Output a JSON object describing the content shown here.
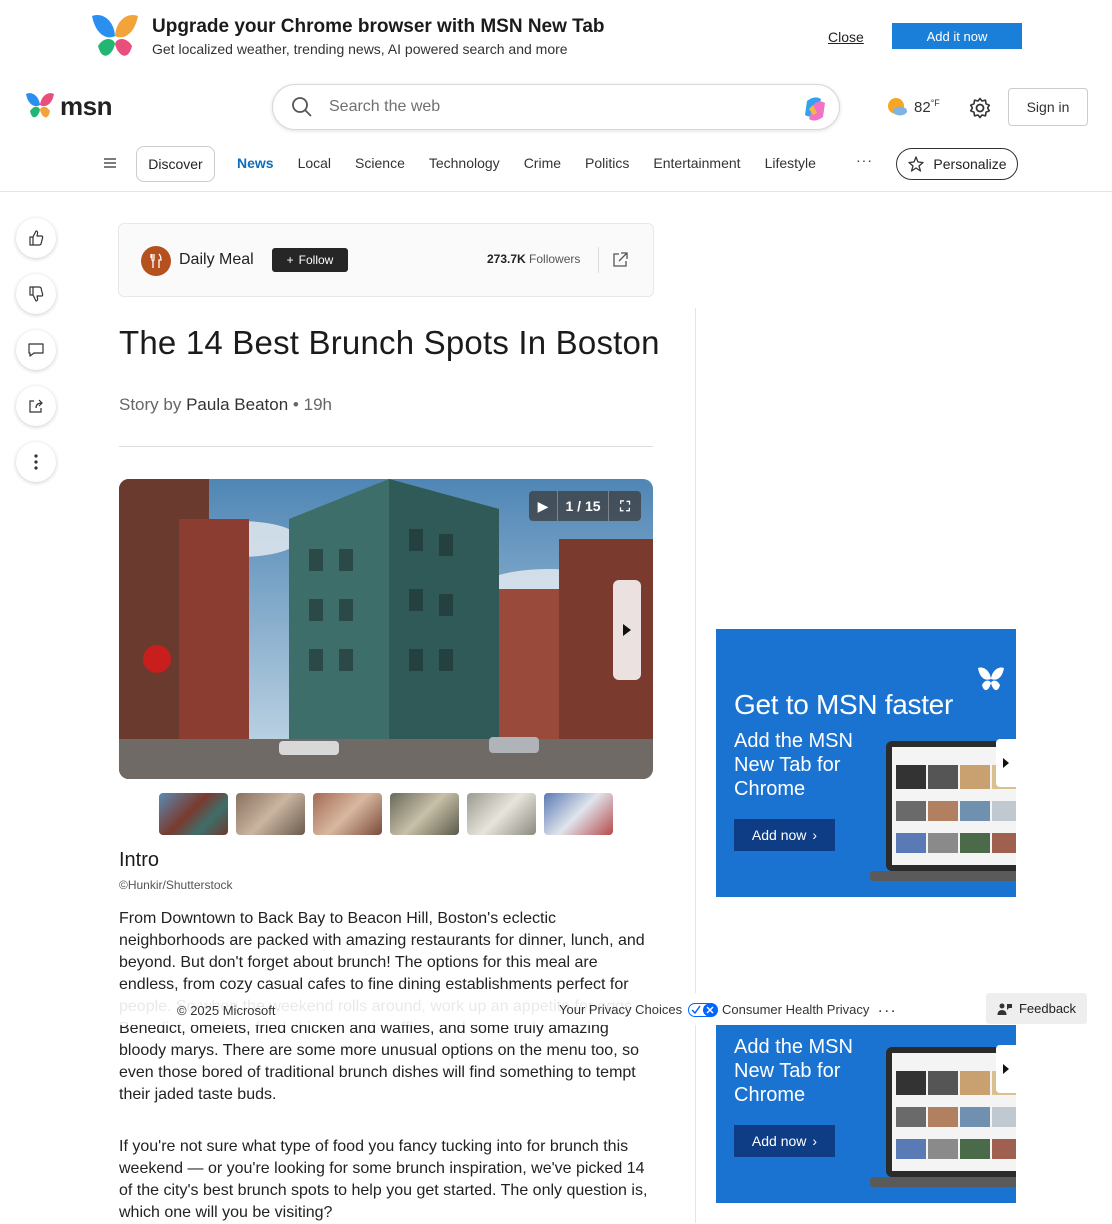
{
  "banner": {
    "title": "Upgrade your Chrome browser with MSN New Tab",
    "subtitle": "Get localized weather, trending news, AI powered search and more",
    "close_label": "Close",
    "add_label": "Add it now"
  },
  "header": {
    "logo_text": "msn",
    "search_placeholder": "Search the web",
    "temperature": "82",
    "temp_unit": "°F",
    "signin_label": "Sign in"
  },
  "nav": {
    "discover": "Discover",
    "items": [
      "News",
      "Local",
      "Science",
      "Technology",
      "Crime",
      "Politics",
      "Entertainment",
      "Lifestyle"
    ],
    "more": "···",
    "personalize": "Personalize"
  },
  "publisher": {
    "name": "Daily Meal",
    "follow_label": "Follow",
    "followers_count": "273.7K",
    "followers_label": "Followers"
  },
  "article": {
    "title": "The 14 Best Brunch Spots In Boston",
    "story_by": "Story by",
    "author": "Paula Beaton",
    "separator": "•",
    "age": "19h",
    "gallery_counter": "1 / 15",
    "section_title": "Intro",
    "image_credit": "©Hunkir/Shutterstock",
    "paragraph1": "From Downtown to Back Bay to Beacon Hill, Boston's eclectic neighborhoods are packed with amazing restaurants for dinner, lunch, and beyond. But don't forget about brunch! The options for this meal are endless, from cozy casual cafes to fine dining establishments perfect for people. So when the weekend rolls around, work up an appetite for eggs Benedict, omelets, fried chicken and waffles, and some truly amazing bloody marys. There are some more unusual options on the menu too, so even those bored of traditional brunch dishes will find something to tempt their jaded taste buds.",
    "paragraph2": "If you're not sure what type of food you fancy tucking into for brunch this weekend — or you're looking for some brunch inspiration, we've picked 14 of the city's best brunch spots to help you get started. The only question is, which one will you be visiting?"
  },
  "footer": {
    "copyright": "© 2025 Microsoft",
    "privacy": "Your Privacy Choices",
    "consumer_health": "Consumer Health Privacy",
    "more": "...",
    "feedback": "Feedback"
  },
  "ad": {
    "title": "Get to MSN faster",
    "subtitle": "Add the MSN New Tab for Chrome",
    "button": "Add now"
  },
  "colors": {
    "accent": "#0f6cbd",
    "ad_blue": "#1a73d1",
    "banner_button": "#1a7fd9"
  }
}
